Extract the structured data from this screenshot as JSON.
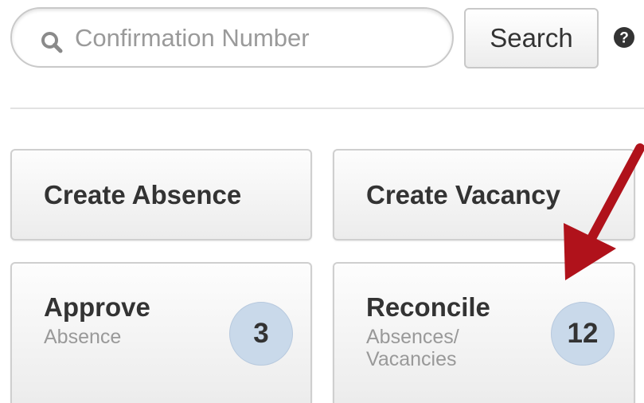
{
  "search": {
    "placeholder": "Confirmation Number",
    "button_label": "Search",
    "icon": "search-icon",
    "help_icon": "help-icon"
  },
  "tiles": [
    {
      "label": "Create Absence"
    },
    {
      "label": "Create Vacancy"
    },
    {
      "title": "Approve",
      "subtitle": "Absence",
      "count": "3"
    },
    {
      "title": "Reconcile",
      "subtitle": "Absences/ Vacancies",
      "count": "12"
    }
  ],
  "colors": {
    "badge": "#c9d9ea",
    "arrow": "#b0121b",
    "text": "#333333",
    "subtext": "#999999"
  }
}
